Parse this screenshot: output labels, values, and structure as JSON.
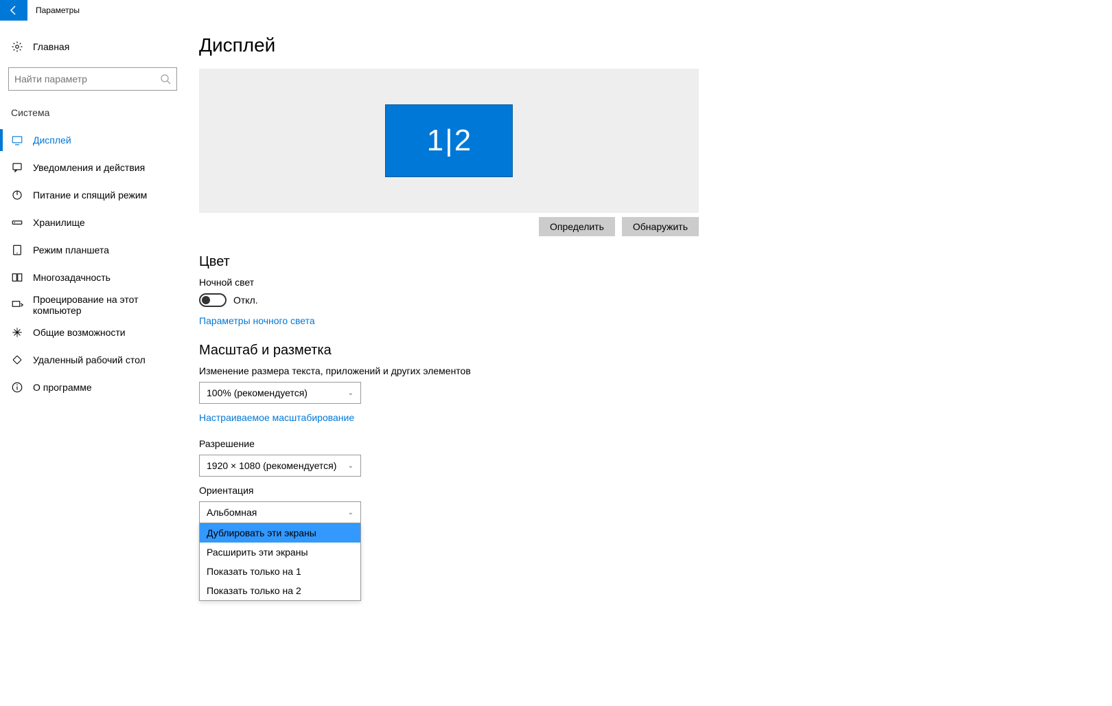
{
  "titlebar": {
    "title": "Параметры"
  },
  "sidebar": {
    "home": "Главная",
    "search_placeholder": "Найти параметр",
    "section": "Система",
    "items": [
      {
        "label": "Дисплей"
      },
      {
        "label": "Уведомления и действия"
      },
      {
        "label": "Питание и спящий режим"
      },
      {
        "label": "Хранилище"
      },
      {
        "label": "Режим планшета"
      },
      {
        "label": "Многозадачность"
      },
      {
        "label": "Проецирование на этот компьютер"
      },
      {
        "label": "Общие возможности"
      },
      {
        "label": "Удаленный рабочий стол"
      },
      {
        "label": "О программе"
      }
    ]
  },
  "main": {
    "title": "Дисплей",
    "monitor_label": "1|2",
    "btn_identify": "Определить",
    "btn_detect": "Обнаружить",
    "color_heading": "Цвет",
    "night_light_label": "Ночной свет",
    "toggle_state": "Откл.",
    "night_light_settings_link": "Параметры ночного света",
    "scale_heading": "Масштаб и разметка",
    "scale_label": "Изменение размера текста, приложений и других элементов",
    "scale_value": "100% (рекомендуется)",
    "custom_scaling_link": "Настраиваемое масштабирование",
    "resolution_label": "Разрешение",
    "resolution_value": "1920 × 1080 (рекомендуется)",
    "orientation_label": "Ориентация",
    "orientation_value": "Альбомная",
    "multi_display_options": [
      "Дублировать эти экраны",
      "Расширить эти экраны",
      "Показать только на 1",
      "Показать только на 2"
    ]
  }
}
